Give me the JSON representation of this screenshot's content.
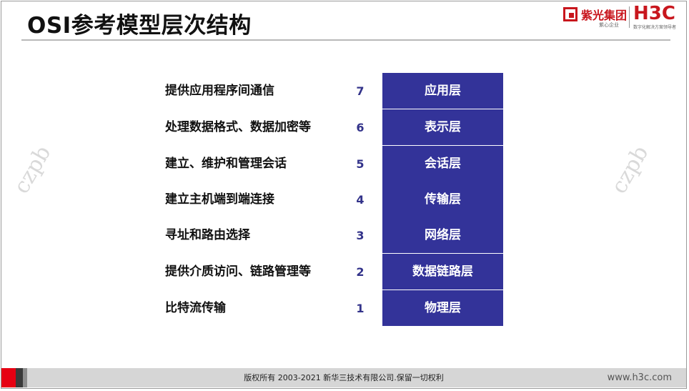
{
  "slide": {
    "title": "OSI参考模型层次结构",
    "watermark": "czpb"
  },
  "logo": {
    "ziguang_text": "紫光集团",
    "ziguang_sub": "紫心企业",
    "h3c_text": "H3C",
    "h3c_sub": "数字化解决方案领导者"
  },
  "layers": [
    {
      "number": "7",
      "name": "应用层",
      "description": "提供应用程序间通信"
    },
    {
      "number": "6",
      "name": "表示层",
      "description": "处理数据格式、数据加密等"
    },
    {
      "number": "5",
      "name": "会话层",
      "description": "建立、维护和管理会话"
    },
    {
      "number": "4",
      "name": "传输层",
      "description": "建立主机端到端连接"
    },
    {
      "number": "3",
      "name": "网络层",
      "description": "寻址和路由选择"
    },
    {
      "number": "2",
      "name": "数据链路层",
      "description": "提供介质访问、链路管理等"
    },
    {
      "number": "1",
      "name": "物理层",
      "description": "比特流传输"
    }
  ],
  "footer": {
    "copyright": "版权所有 2003-2021 新华三技术有限公司.保留一切权利",
    "site": "www.h3c.com"
  },
  "colors": {
    "layer_box": "#333399",
    "number_text": "#33338a",
    "brand_red": "#c8161d",
    "footer_red": "#e60012"
  }
}
